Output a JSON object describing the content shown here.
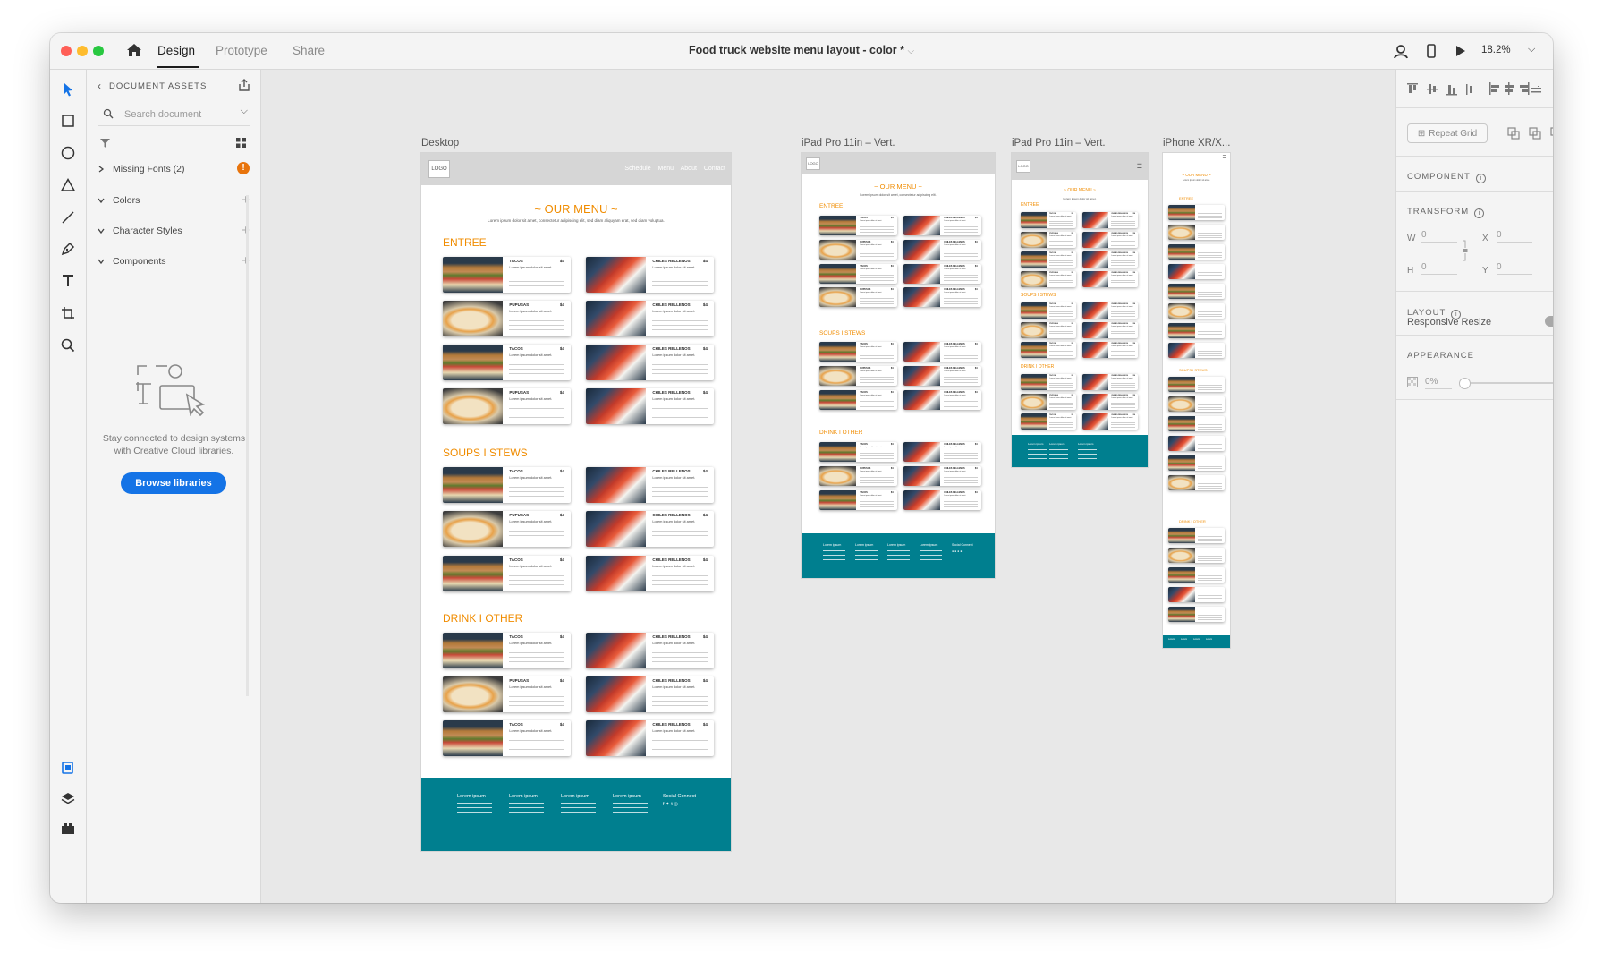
{
  "window": {
    "title": "Food truck website menu layout - color *",
    "zoom": "18.2%"
  },
  "nav": {
    "tabs": [
      {
        "label": "Design",
        "active": true
      },
      {
        "label": "Prototype",
        "active": false
      },
      {
        "label": "Share",
        "active": false
      }
    ]
  },
  "assets": {
    "header": "DOCUMENT ASSETS",
    "search_placeholder": "Search document",
    "missing_fonts": "Missing Fonts (2)",
    "sections": [
      "Colors",
      "Character Styles",
      "Components"
    ],
    "empty_text": "Stay connected to design systems with Creative Cloud libraries.",
    "browse_label": "Browse libraries"
  },
  "canvas": {
    "artboards": [
      {
        "label": "Desktop",
        "logo": "LOGO",
        "nav_links": "Schedule Menu About Contact",
        "heading": "~ OUR MENU ~",
        "subtitle": "Lorem ipsum dolor sit amet, consectetur adipiscing elit, sed diam aliquyam erat, sed diam voluptua.",
        "categories": [
          "ENTREE",
          "SOUPS I STEWS",
          "DRINK I OTHER"
        ],
        "footer_cols": [
          "Lorem ipsum",
          "Lorem ipsum",
          "Lorem ipsum",
          "Lorem ipsum"
        ],
        "social_label": "Social Connect",
        "social_icons": "f ✦ t ◎"
      },
      {
        "label": "iPad Pro 11in – Vert.",
        "logo": "LOGO",
        "heading": "~ OUR MENU ~",
        "subtitle": "Lorem ipsum dolor sit amet, consectetur adipiscing elit.",
        "categories": [
          "ENTREE",
          "SOUPS I STEWS",
          "DRINK I OTHER"
        ],
        "footer_cols": [
          "Lorem ipsum",
          "Lorem ipsum",
          "Lorem ipsum",
          "Lorem ipsum"
        ],
        "social_label": "Social Connect"
      },
      {
        "label": "iPad Pro 11in – Vert.",
        "logo": "LOGO",
        "heading": "~ OUR MENU ~",
        "subtitle": "Lorem ipsum dolor sit amet.",
        "categories": [
          "ENTREE",
          "SOUPS I STEWS",
          "DRINK I OTHER"
        ],
        "footer_cols": [
          "Lorem ipsum",
          "Lorem ipsum",
          "Lorem ipsum"
        ]
      },
      {
        "label": "iPhone XR/X...",
        "heading": "~ OUR MENU ~",
        "subtitle": "Lorem ipsum dolor sit amet.",
        "categories": [
          "ENTREE",
          "SOUPS I STEWS",
          "DRINK I OTHER"
        ],
        "footer_cols": [
          "Lorem",
          "Lorem",
          "Lorem",
          "Lorem"
        ]
      }
    ],
    "menu_items": {
      "left": [
        {
          "title": "TACOS",
          "price": "$4",
          "desc": "Lorem ipsum dolor sit amet."
        },
        {
          "title": "PUPUSAS",
          "price": "$4",
          "desc": "Lorem ipsum dolor sit amet."
        }
      ],
      "right": {
        "title": "CHILES RELLENOS",
        "price": "$4",
        "desc": "Lorem ipsum dolor sit amet."
      }
    }
  },
  "properties": {
    "repeat_grid": "Repeat Grid",
    "component": "COMPONENT",
    "transform": "TRANSFORM",
    "w_label": "W",
    "w_value": "0",
    "x_label": "X",
    "x_value": "0",
    "h_label": "H",
    "h_value": "0",
    "y_label": "Y",
    "y_value": "0",
    "layout": "LAYOUT",
    "responsive_resize": "Responsive Resize",
    "appearance": "APPEARANCE",
    "opacity": "0%"
  },
  "colors": {
    "accent": "#f08c00",
    "footer": "#007f8f",
    "primary_button": "#1473e6"
  }
}
